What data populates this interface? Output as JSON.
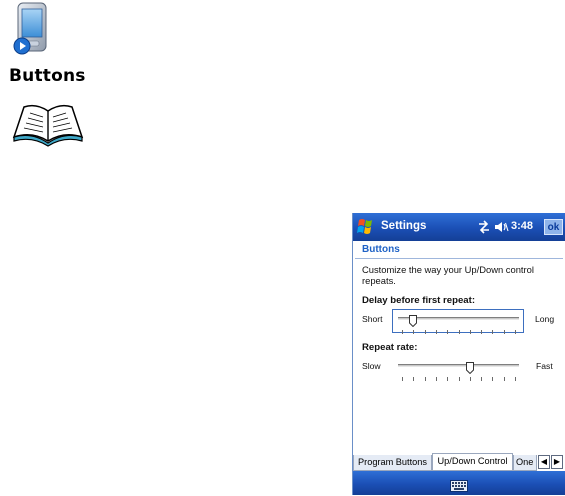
{
  "manual": {
    "heading": "Buttons",
    "device_icon": "pda-device-icon",
    "book_icon": "open-book-icon"
  },
  "device": {
    "titlebar": {
      "title": "Settings",
      "time": "3:48",
      "ok_label": "ok",
      "icons": [
        "start-flag-icon",
        "connectivity-icon",
        "speaker-icon"
      ]
    },
    "page_title": "Buttons",
    "description": "Customize the way your Up/Down control repeats.",
    "sliders": [
      {
        "label": "Delay before first repeat:",
        "min_label": "Short",
        "max_label": "Long",
        "value": 0.1,
        "ticks": 11,
        "focused": true
      },
      {
        "label": "Repeat rate:",
        "min_label": "Slow",
        "max_label": "Fast",
        "value": 0.6,
        "ticks": 11,
        "focused": false
      }
    ],
    "tabs": [
      {
        "label": "Program Buttons",
        "active": false
      },
      {
        "label": "Up/Down Control",
        "active": true
      },
      {
        "label": "One",
        "active": false
      }
    ],
    "tab_scroll": {
      "left_icon": "arrow-left-icon",
      "right_icon": "arrow-right-icon"
    },
    "input_icon": "keyboard-icon",
    "colors": {
      "titlebar": "#1b4fb5",
      "accent": "#1f62c6"
    }
  }
}
